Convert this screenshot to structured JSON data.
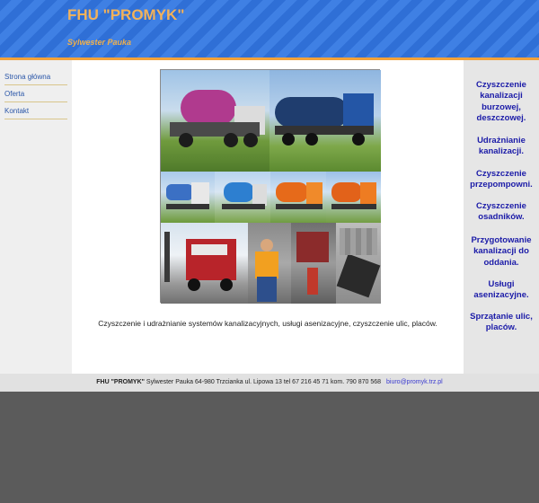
{
  "header": {
    "title": "FHU \"PROMYK\"",
    "subtitle": "Sylwester Pauka"
  },
  "nav": {
    "items": [
      {
        "label": "Strona główna"
      },
      {
        "label": "Oferta"
      },
      {
        "label": "Kontakt"
      }
    ]
  },
  "main": {
    "description": "Czyszczenie i udrażnianie systemów kanalizacyjnych, usługi asenizacyjne, czyszczenie ulic, placów."
  },
  "services": [
    "Czyszczenie kanalizacji burzowej, deszczowej.",
    "Udrażnianie kanalizacji.",
    "Czyszczenie przepompowni.",
    "Czyszczenie osadników.",
    "Przygotowanie kanalizacji do oddania.",
    "Usługi asenizacyjne.",
    "Sprzątanie ulic, placów."
  ],
  "footer": {
    "brand": "FHU \"PROMYK\"",
    "address": "Sylwester Pauka 64-980 Trzcianka ul. Lipowa 13 tel 67 216 45 71 kom.  790 870 568",
    "email": "biuro@promyk.trz.pl"
  },
  "colors": {
    "header_blue": "#2f6fd6",
    "header_accent": "#f2a23a",
    "title_orange": "#f3b25a",
    "nav_link": "#2a56a8",
    "service_text": "#1b1ba8"
  }
}
